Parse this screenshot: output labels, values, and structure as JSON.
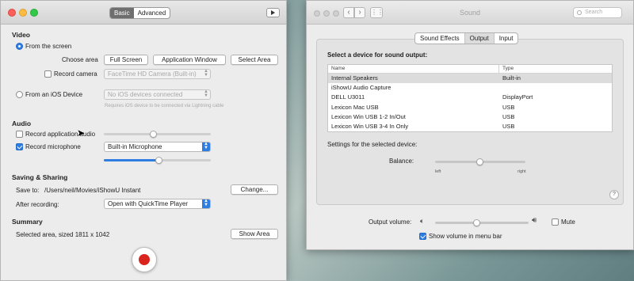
{
  "left": {
    "tabs": [
      {
        "label": "Basic",
        "active": true
      },
      {
        "label": "Advanced",
        "active": false
      }
    ],
    "video": {
      "heading": "Video",
      "from_screen_label": "From the screen",
      "choose_area_label": "Choose area",
      "full_screen_btn": "Full Screen",
      "app_window_btn": "Application Window",
      "select_area_btn": "Select Area",
      "record_camera_label": "Record camera",
      "camera_select": "FaceTime HD Camera (Built-in)",
      "ios_label": "From an iOS Device",
      "ios_select": "No iOS devices connected",
      "ios_hint": "Requires iOS device to be connected via Lightning cable"
    },
    "audio": {
      "heading": "Audio",
      "record_app_audio_label": "Record application audio",
      "record_mic_label": "Record microphone",
      "mic_select": "Built-in Microphone",
      "mic_level": 0.52,
      "app_audio_level": 0.47
    },
    "saving": {
      "heading": "Saving & Sharing",
      "save_to_label": "Save to:",
      "save_path": "/Users/neil/Movies/iShowU Instant",
      "change_btn": "Change...",
      "after_recording_label": "After recording:",
      "after_select": "Open with QuickTime Player"
    },
    "summary": {
      "heading": "Summary",
      "text": "Selected area, sized 1811 x 1042",
      "show_area_btn": "Show Area"
    }
  },
  "right": {
    "title": "Sound",
    "search_placeholder": "Search",
    "tabs": [
      {
        "label": "Sound Effects",
        "active": false
      },
      {
        "label": "Output",
        "active": true
      },
      {
        "label": "Input",
        "active": false
      }
    ],
    "select_heading": "Select a device for sound output:",
    "columns": {
      "name": "Name",
      "type": "Type"
    },
    "devices": [
      {
        "name": "Internal Speakers",
        "type": "Built-in",
        "selected": true
      },
      {
        "name": "iShowU Audio Capture",
        "type": "",
        "selected": false
      },
      {
        "name": "DELL U3011",
        "type": "DisplayPort",
        "selected": false
      },
      {
        "name": "Lexicon Mac USB",
        "type": "USB",
        "selected": false
      },
      {
        "name": "Lexicon Win USB 1-2 In/Out",
        "type": "USB",
        "selected": false
      },
      {
        "name": "Lexicon Win USB 3-4 In Only",
        "type": "USB",
        "selected": false
      }
    ],
    "settings_label": "Settings for the selected device:",
    "balance_label": "Balance:",
    "left_label": "left",
    "right_label": "right",
    "balance_value": 0.5,
    "help_label": "?",
    "output_volume_label": "Output volume:",
    "output_volume": 0.45,
    "mute_label": "Mute",
    "show_volume_label": "Show volume in menu bar"
  },
  "colors": {
    "accent": "#2f7de1",
    "record": "#d9251d"
  }
}
